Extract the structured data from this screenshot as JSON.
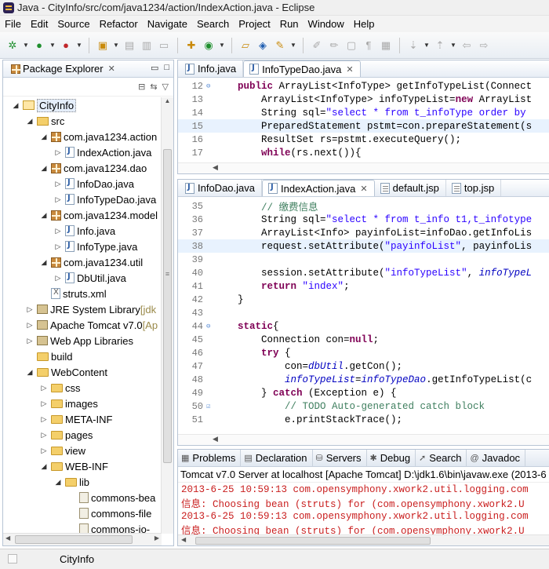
{
  "window": {
    "title": "Java - CityInfo/src/com/java1234/action/IndexAction.java - Eclipse"
  },
  "menu": [
    "File",
    "Edit",
    "Source",
    "Refactor",
    "Navigate",
    "Search",
    "Project",
    "Run",
    "Window",
    "Help"
  ],
  "package_explorer": {
    "title": "Package Explorer",
    "tree": [
      {
        "label": "CityInfo",
        "icon": "project-icon",
        "twisty": "expanded"
      },
      {
        "label": "src",
        "icon": "source-folder-icon",
        "twisty": "expanded"
      },
      {
        "label": "com.java1234.action",
        "icon": "package-icon",
        "twisty": "expanded"
      },
      {
        "label": "IndexAction.java",
        "icon": "java-file-icon",
        "twisty": "collapsed"
      },
      {
        "label": "com.java1234.dao",
        "icon": "package-icon",
        "twisty": "expanded"
      },
      {
        "label": "InfoDao.java",
        "icon": "java-file-icon",
        "twisty": "collapsed"
      },
      {
        "label": "InfoTypeDao.java",
        "icon": "java-file-icon",
        "twisty": "collapsed"
      },
      {
        "label": "com.java1234.model",
        "icon": "package-icon",
        "twisty": "expanded"
      },
      {
        "label": "Info.java",
        "icon": "java-file-icon",
        "twisty": "collapsed"
      },
      {
        "label": "InfoType.java",
        "icon": "java-file-icon",
        "twisty": "collapsed"
      },
      {
        "label": "com.java1234.util",
        "icon": "package-icon",
        "twisty": "expanded"
      },
      {
        "label": "DbUtil.java",
        "icon": "java-file-icon",
        "twisty": "collapsed"
      },
      {
        "label": "struts.xml",
        "icon": "xml-file-icon",
        "twisty": "none"
      },
      {
        "label": "JRE System Library",
        "suffix": " [jdk",
        "icon": "library-icon",
        "twisty": "collapsed"
      },
      {
        "label": "Apache Tomcat v7.0",
        "suffix": " [Ap",
        "icon": "library-icon",
        "twisty": "collapsed"
      },
      {
        "label": "Web App Libraries",
        "icon": "library-icon",
        "twisty": "collapsed"
      },
      {
        "label": "build",
        "icon": "folder-icon",
        "twisty": "none"
      },
      {
        "label": "WebContent",
        "icon": "folder-icon",
        "twisty": "expanded"
      },
      {
        "label": "css",
        "icon": "folder-icon",
        "twisty": "collapsed"
      },
      {
        "label": "images",
        "icon": "folder-icon",
        "twisty": "collapsed"
      },
      {
        "label": "META-INF",
        "icon": "folder-icon",
        "twisty": "collapsed"
      },
      {
        "label": "pages",
        "icon": "folder-icon",
        "twisty": "collapsed"
      },
      {
        "label": "view",
        "icon": "folder-icon",
        "twisty": "collapsed"
      },
      {
        "label": "WEB-INF",
        "icon": "folder-icon",
        "twisty": "expanded"
      },
      {
        "label": "lib",
        "icon": "folder-icon",
        "twisty": "expanded"
      },
      {
        "label": "commons-bea",
        "icon": "jar-icon",
        "twisty": "none"
      },
      {
        "label": "commons-file",
        "icon": "jar-icon",
        "twisty": "none"
      },
      {
        "label": "commons-io-",
        "icon": "jar-icon",
        "twisty": "none"
      }
    ]
  },
  "editor_top": {
    "tabs": [
      {
        "label": "Info.java",
        "active": false,
        "closable": false
      },
      {
        "label": "InfoTypeDao.java",
        "active": true,
        "closable": true
      }
    ],
    "lines": [
      {
        "n": "12",
        "fold": "⊖",
        "hl": false,
        "segs": [
          [
            "",
            "    "
          ],
          [
            "kw",
            "public"
          ],
          [
            "",
            " ArrayList<InfoType> getInfoTypeList(Connect"
          ]
        ]
      },
      {
        "n": "13",
        "fold": "",
        "hl": false,
        "segs": [
          [
            "",
            "        ArrayList<InfoType> infoTypeList="
          ],
          [
            "kw",
            "new"
          ],
          [
            "",
            " ArrayList"
          ]
        ]
      },
      {
        "n": "14",
        "fold": "",
        "hl": false,
        "segs": [
          [
            "",
            "        String sql="
          ],
          [
            "st",
            "\"select * from t_infoType order by"
          ]
        ]
      },
      {
        "n": "15",
        "fold": "",
        "hl": true,
        "segs": [
          [
            "",
            "        PreparedStatement pstmt=con.prepareStatement(s"
          ]
        ]
      },
      {
        "n": "16",
        "fold": "",
        "hl": false,
        "segs": [
          [
            "",
            "        ResultSet rs=pstmt.executeQuery();"
          ]
        ]
      },
      {
        "n": "17",
        "fold": "",
        "hl": false,
        "segs": [
          [
            "",
            "        "
          ],
          [
            "kw",
            "while"
          ],
          [
            "",
            "(rs.next()){"
          ]
        ]
      }
    ]
  },
  "editor_bottom": {
    "tabs": [
      {
        "label": "InfoDao.java",
        "active": false,
        "closable": false,
        "icon": "java-file-icon"
      },
      {
        "label": "IndexAction.java",
        "active": true,
        "closable": true,
        "icon": "java-file-icon"
      },
      {
        "label": "default.jsp",
        "active": false,
        "closable": false,
        "icon": "jsp-file-icon"
      },
      {
        "label": "top.jsp",
        "active": false,
        "closable": false,
        "icon": "jsp-file-icon"
      }
    ],
    "lines": [
      {
        "n": "35",
        "fold": "",
        "hl": false,
        "segs": [
          [
            "",
            "        "
          ],
          [
            "cm",
            "// 缴费信息"
          ]
        ]
      },
      {
        "n": "36",
        "fold": "",
        "hl": false,
        "segs": [
          [
            "",
            "        String sql="
          ],
          [
            "st",
            "\"select * from t_info t1,t_infotype"
          ]
        ]
      },
      {
        "n": "37",
        "fold": "",
        "hl": false,
        "segs": [
          [
            "",
            "        ArrayList<Info> payinfoList=infoDao.getInfoLis"
          ]
        ]
      },
      {
        "n": "38",
        "fold": "",
        "hl": true,
        "segs": [
          [
            "",
            "        request.setAttribute("
          ],
          [
            "st",
            "\"payinfoList\""
          ],
          [
            "",
            ", payinfoLis"
          ]
        ]
      },
      {
        "n": "39",
        "fold": "",
        "hl": false,
        "segs": [
          [
            "",
            ""
          ]
        ]
      },
      {
        "n": "40",
        "fold": "",
        "hl": false,
        "segs": [
          [
            "",
            "        session.setAttribute("
          ],
          [
            "st",
            "\"infoTypeList\""
          ],
          [
            "",
            ", "
          ],
          [
            "it",
            "infoTypeL"
          ]
        ]
      },
      {
        "n": "41",
        "fold": "",
        "hl": false,
        "segs": [
          [
            "",
            "        "
          ],
          [
            "kw",
            "return"
          ],
          [
            "",
            " "
          ],
          [
            "st",
            "\"index\""
          ],
          [
            "",
            ";"
          ]
        ]
      },
      {
        "n": "42",
        "fold": "",
        "hl": false,
        "segs": [
          [
            "",
            "    }"
          ]
        ]
      },
      {
        "n": "43",
        "fold": "",
        "hl": false,
        "segs": [
          [
            "",
            ""
          ]
        ]
      },
      {
        "n": "44",
        "fold": "⊖",
        "hl": false,
        "segs": [
          [
            "",
            "    "
          ],
          [
            "kw",
            "static"
          ],
          [
            "",
            "{"
          ]
        ]
      },
      {
        "n": "45",
        "fold": "",
        "hl": false,
        "segs": [
          [
            "",
            "        Connection con="
          ],
          [
            "kw",
            "null"
          ],
          [
            "",
            ";"
          ]
        ]
      },
      {
        "n": "46",
        "fold": "",
        "hl": false,
        "segs": [
          [
            "",
            "        "
          ],
          [
            "kw",
            "try"
          ],
          [
            "",
            " {"
          ]
        ]
      },
      {
        "n": "47",
        "fold": "",
        "hl": false,
        "segs": [
          [
            "",
            "            con="
          ],
          [
            "it",
            "dbUtil"
          ],
          [
            "",
            ".getCon();"
          ]
        ]
      },
      {
        "n": "48",
        "fold": "",
        "hl": false,
        "segs": [
          [
            "",
            "            "
          ],
          [
            "it",
            "infoTypeList"
          ],
          [
            "",
            "="
          ],
          [
            "it",
            "infoTypeDao"
          ],
          [
            "",
            ".getInfoTypeList(c"
          ]
        ]
      },
      {
        "n": "49",
        "fold": "",
        "hl": false,
        "segs": [
          [
            "",
            "        } "
          ],
          [
            "kw",
            "catch"
          ],
          [
            "",
            " (Exception e) {"
          ]
        ]
      },
      {
        "n": "50",
        "fold": "☑",
        "hl": false,
        "segs": [
          [
            "",
            "            "
          ],
          [
            "cm",
            "// TODO Auto-generated catch block"
          ]
        ]
      },
      {
        "n": "51",
        "fold": "",
        "hl": false,
        "segs": [
          [
            "",
            "            e.printStackTrace();"
          ]
        ]
      }
    ]
  },
  "console": {
    "tabs": [
      {
        "label": "Problems",
        "icon": "problems-icon",
        "sym": "▦"
      },
      {
        "label": "Declaration",
        "icon": "declaration-icon",
        "sym": "▤"
      },
      {
        "label": "Servers",
        "icon": "servers-icon",
        "sym": "⛁"
      },
      {
        "label": "Debug",
        "icon": "debug-icon",
        "sym": "✱"
      },
      {
        "label": "Search",
        "icon": "search-icon",
        "sym": "➚"
      },
      {
        "label": "Javadoc",
        "icon": "javadoc-icon",
        "sym": "@"
      }
    ],
    "header": "Tomcat v7.0 Server at localhost [Apache Tomcat] D:\\jdk1.6\\bin\\javaw.exe (2013-6",
    "lines": [
      "2013-6-25 10:59:13 com.opensymphony.xwork2.util.logging.com",
      "信息: Choosing bean (struts) for (com.opensymphony.xwork2.U",
      "2013-6-25 10:59:13 com.opensymphony.xwork2.util.logging.com",
      "信息: Choosing bean (struts) for (com.opensymphony.xwork2.U"
    ]
  },
  "statusbar": {
    "text": "CityInfo"
  }
}
